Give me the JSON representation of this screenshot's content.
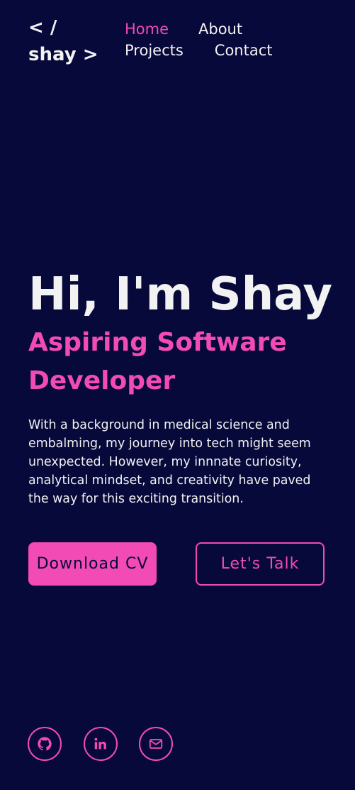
{
  "header": {
    "logo_line1": "< /",
    "logo_line2": "shay >"
  },
  "nav": {
    "items": [
      {
        "label": "Home",
        "active": true
      },
      {
        "label": "About"
      },
      {
        "label": "Projects"
      },
      {
        "label": "Contact"
      }
    ]
  },
  "hero": {
    "title": "Hi, I'm Shay",
    "subtitle": "Aspiring Software Developer",
    "description": "With a background in medical science and embalming, my journey into tech might seem unexpected. However, my innnate curiosity, analytical mindset, and creativity have paved the way for this exciting transition."
  },
  "buttons": {
    "download": "Download CV",
    "talk": "Let's Talk"
  },
  "social": [
    {
      "icon": "github-icon"
    },
    {
      "icon": "linkedin-icon"
    },
    {
      "icon": "mail-icon"
    }
  ],
  "colors": {
    "background": "#07093a",
    "accent": "#f24bb5",
    "text": "#f2f2f2"
  }
}
